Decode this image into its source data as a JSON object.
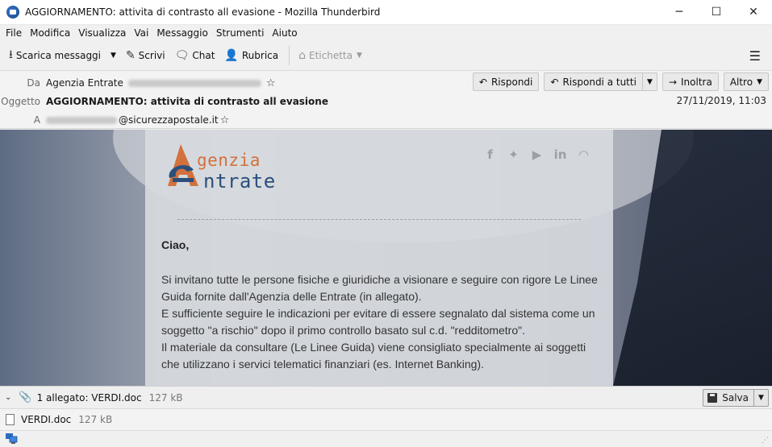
{
  "window": {
    "title": "AGGIORNAMENTO: attivita di contrasto all evasione - Mozilla Thunderbird",
    "minimize": "─",
    "maximize": "☐",
    "close": "✕"
  },
  "menu": [
    "File",
    "Modifica",
    "Visualizza",
    "Vai",
    "Messaggio",
    "Strumenti",
    "Aiuto"
  ],
  "toolbar": {
    "get_messages": "Scarica messaggi",
    "write": "Scrivi",
    "chat": "Chat",
    "address_book": "Rubrica",
    "tag": "Etichetta"
  },
  "header": {
    "from_label": "Da",
    "from_value": "Agenzia Entrate",
    "subject_label": "Oggetto",
    "subject_value": "AGGIORNAMENTO: attivita di contrasto all evasione",
    "to_label": "A",
    "to_value": "@sicurezzapostale.it",
    "date": "27/11/2019, 11:03",
    "reply": "Rispondi",
    "reply_all": "Rispondi a tutti",
    "forward": "Inoltra",
    "more": "Altro"
  },
  "email": {
    "logo_line1": "genzia",
    "logo_line2": "ntrate",
    "greeting": "Ciao,",
    "paragraph1": "Si invitano tutte le persone fisiche e giuridiche a visionare e seguire con rigore Le Linee Guida fornite dall'Agenzia delle Entrate (in allegato).",
    "paragraph2": "E sufficiente seguire le indicazioni per evitare di essere segnalato dal sistema come un soggetto \"a rischio\" dopo il primo controllo basato sul c.d. \"redditometro\".",
    "paragraph3": "Il materiale da consultare (Le Linee Guida) viene consigliato specialmente ai soggetti che utilizzano i servici telematici finanziari (es. Internet Banking)."
  },
  "attachments": {
    "summary": "1 allegato: VERDI.doc",
    "summary_size": "127 kB",
    "save": "Salva",
    "file_name": "VERDI.doc",
    "file_size": "127 kB"
  }
}
